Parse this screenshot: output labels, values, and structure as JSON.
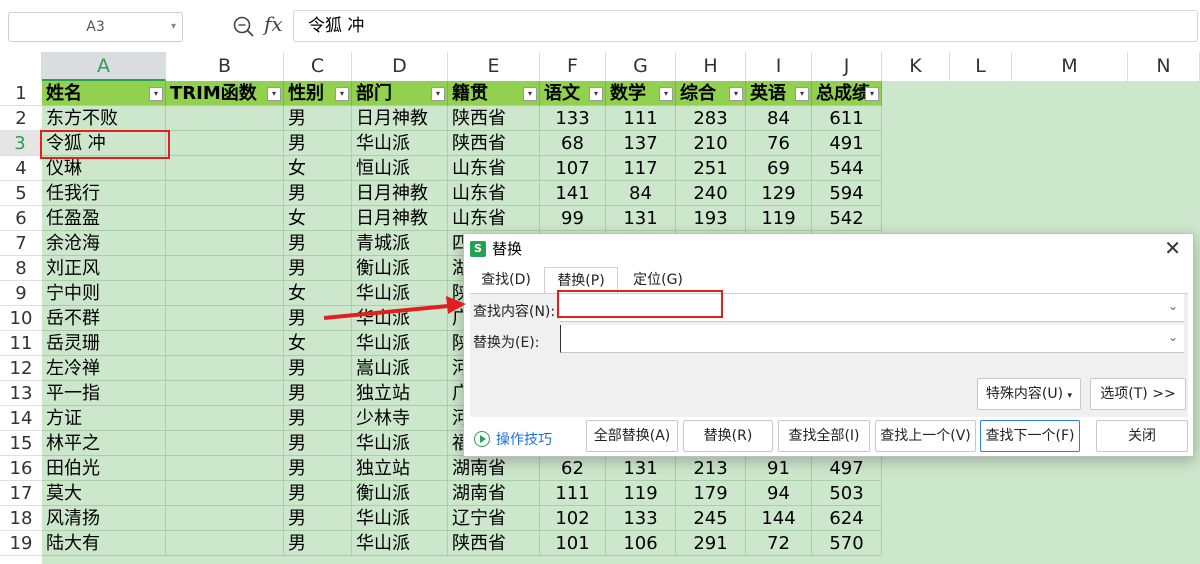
{
  "formula_bar": {
    "cell_ref": "A3",
    "fx_label": "fx",
    "content": "令狐 冲"
  },
  "columns": [
    "A",
    "B",
    "C",
    "D",
    "E",
    "F",
    "G",
    "H",
    "I",
    "J",
    "K",
    "L",
    "M",
    "N"
  ],
  "row_numbers": [
    "1",
    "2",
    "3",
    "4",
    "5",
    "6",
    "7",
    "8",
    "9",
    "10",
    "11",
    "12",
    "13",
    "14",
    "15",
    "16",
    "17",
    "18",
    "19"
  ],
  "headers": [
    "姓名",
    "TRIM函数",
    "性别",
    "部门",
    "籍贯",
    "语文",
    "数学",
    "综合",
    "英语",
    "总成绩"
  ],
  "rows": [
    [
      "东方不败",
      "",
      "男",
      "日月神教",
      "陕西省",
      "133",
      "111",
      "283",
      "84",
      "611"
    ],
    [
      "令狐 冲",
      "",
      "男",
      "华山派",
      "陕西省",
      "68",
      "137",
      "210",
      "76",
      "491"
    ],
    [
      "仪琳",
      "",
      "女",
      "恒山派",
      "山东省",
      "107",
      "117",
      "251",
      "69",
      "544"
    ],
    [
      "任我行",
      "",
      "男",
      "日月神教",
      "山东省",
      "141",
      "84",
      "240",
      "129",
      "594"
    ],
    [
      "任盈盈",
      "",
      "女",
      "日月神教",
      "山东省",
      "99",
      "131",
      "193",
      "119",
      "542"
    ],
    [
      "余沧海",
      "",
      "男",
      "青城派",
      "四",
      "",
      "",
      "",
      "",
      ""
    ],
    [
      "刘正风",
      "",
      "男",
      "衡山派",
      "湖",
      "",
      "",
      "",
      "",
      ""
    ],
    [
      "宁中则",
      "",
      "女",
      "华山派",
      "陕",
      "",
      "",
      "",
      "",
      ""
    ],
    [
      "岳不群",
      "",
      "男",
      "华山派",
      "广",
      "",
      "",
      "",
      "",
      ""
    ],
    [
      "岳灵珊",
      "",
      "女",
      "华山派",
      "陕",
      "",
      "",
      "",
      "",
      ""
    ],
    [
      "左冷禅",
      "",
      "男",
      "嵩山派",
      "河",
      "",
      "",
      "",
      "",
      ""
    ],
    [
      "平一指",
      "",
      "男",
      "独立站",
      "广",
      "",
      "",
      "",
      "",
      ""
    ],
    [
      "方证",
      "",
      "男",
      "少林寺",
      "河",
      "",
      "",
      "",
      "",
      ""
    ],
    [
      "林平之",
      "",
      "男",
      "华山派",
      "福",
      "",
      "",
      "",
      "",
      ""
    ],
    [
      "田伯光",
      "",
      "男",
      "独立站",
      "湖南省",
      "62",
      "131",
      "213",
      "91",
      "497"
    ],
    [
      "莫大",
      "",
      "男",
      "衡山派",
      "湖南省",
      "111",
      "119",
      "179",
      "94",
      "503"
    ],
    [
      "风清扬",
      "",
      "男",
      "华山派",
      "辽宁省",
      "102",
      "133",
      "245",
      "144",
      "624"
    ],
    [
      "陆大有",
      "",
      "男",
      "华山派",
      "陕西省",
      "101",
      "106",
      "291",
      "72",
      "570"
    ]
  ],
  "dialog": {
    "title": "替换",
    "logo": "S",
    "close": "✕",
    "tabs": [
      "查找(D)",
      "替换(P)",
      "定位(G)"
    ],
    "find_label": "查找内容(N):",
    "find_value": "",
    "replace_label": "替换为(E):",
    "replace_value": "",
    "special_btn": "特殊内容(U)",
    "options_btn": "选项(T) >>",
    "tips": "操作技巧",
    "buttons": [
      "全部替换(A)",
      "替换(R)",
      "查找全部(I)",
      "查找上一个(V)",
      "查找下一个(F)",
      "关闭"
    ]
  }
}
